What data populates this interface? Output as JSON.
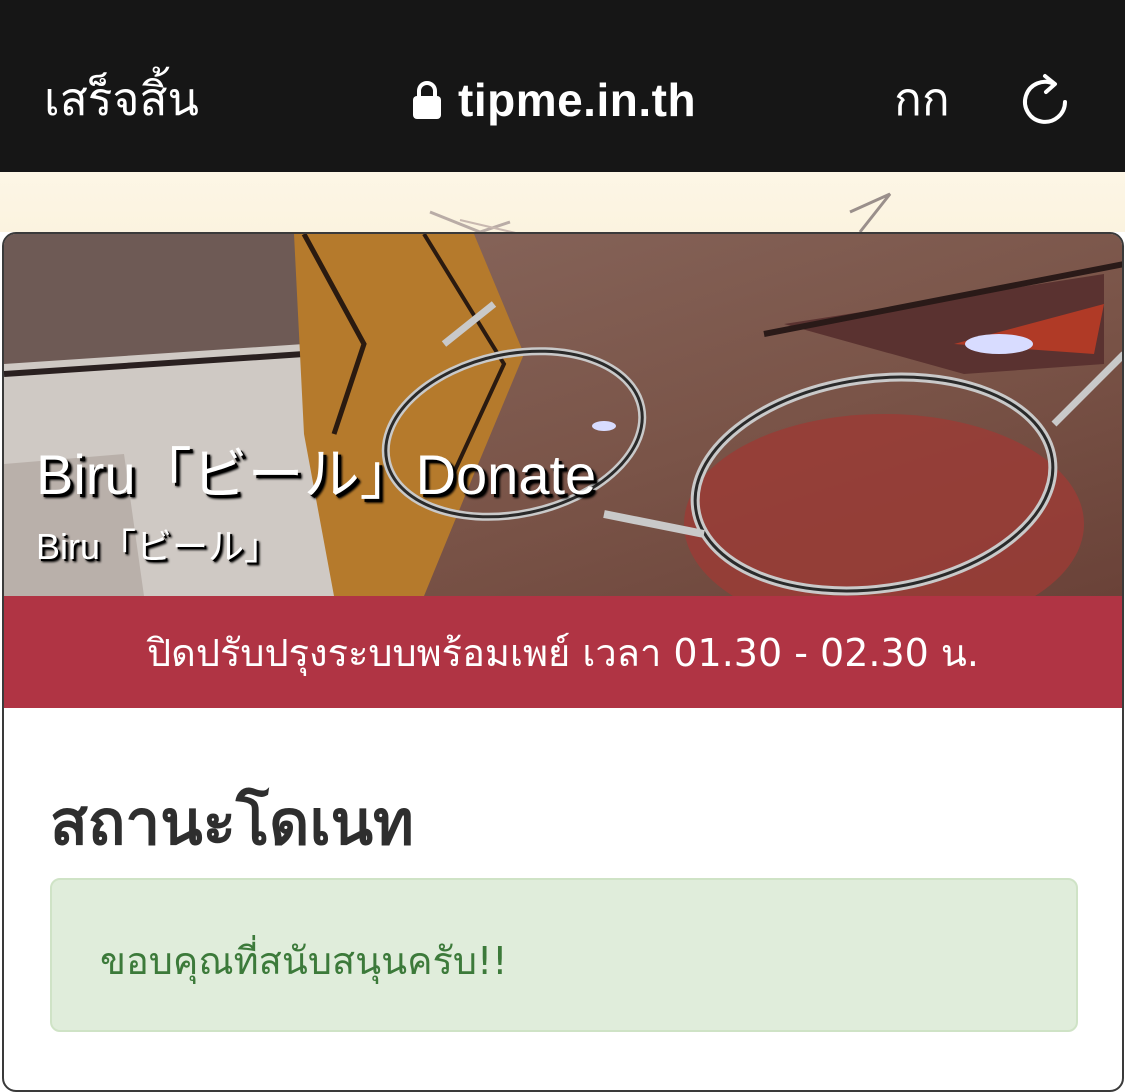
{
  "browser": {
    "done_label": "เสร็จสิ้น",
    "url": "tipme.in.th",
    "text_size_label": "กก",
    "lock_icon": "lock-icon",
    "reload_icon": "reload-icon"
  },
  "banner": {
    "title": "Biru「ビール」Donate",
    "subtitle": "Biru「ビール」"
  },
  "notice": {
    "text": "ปิดปรับปรุงระบบพร้อมเพย์ เวลา 01.30 - 02.30 น.",
    "color": "#b03444"
  },
  "status": {
    "heading": "สถานะโดเนท",
    "message": "ขอบคุณที่สนับสนุนครับ!!",
    "message_color": "#3c7a3a",
    "background": "#e0eddb"
  }
}
